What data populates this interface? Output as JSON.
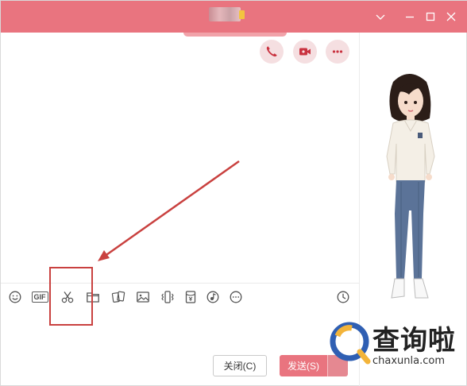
{
  "window": {
    "chrome_color": "#e9747f"
  },
  "title_bar": {
    "contact_name_blurred": true,
    "controls": {
      "dropdown_icon": "chevron-down-icon",
      "minimize_icon": "minimize-icon",
      "maximize_icon": "maximize-icon",
      "close_icon": "close-icon"
    }
  },
  "call_buttons": [
    {
      "icon": "phone-icon",
      "color": "#c9323f"
    },
    {
      "icon": "video-camera-icon",
      "color": "#c9323f"
    },
    {
      "icon": "more-icon",
      "color": "#c9323f"
    }
  ],
  "toolbar": {
    "gif_label": "GIF",
    "tools": [
      "emoji-icon",
      "gif-icon",
      "scissors-icon",
      "folder-icon",
      "sticker-icon",
      "image-icon",
      "shake-icon",
      "red-packet-icon",
      "music-icon",
      "more-icon",
      "history-clock-icon"
    ]
  },
  "footer": {
    "close_label": "关闭(C)",
    "send_label": "发送(S)"
  },
  "annotation": {
    "highlight_color": "#c9413f"
  },
  "watermark": {
    "brand": "查询啦",
    "url": "chaxunla.com"
  }
}
